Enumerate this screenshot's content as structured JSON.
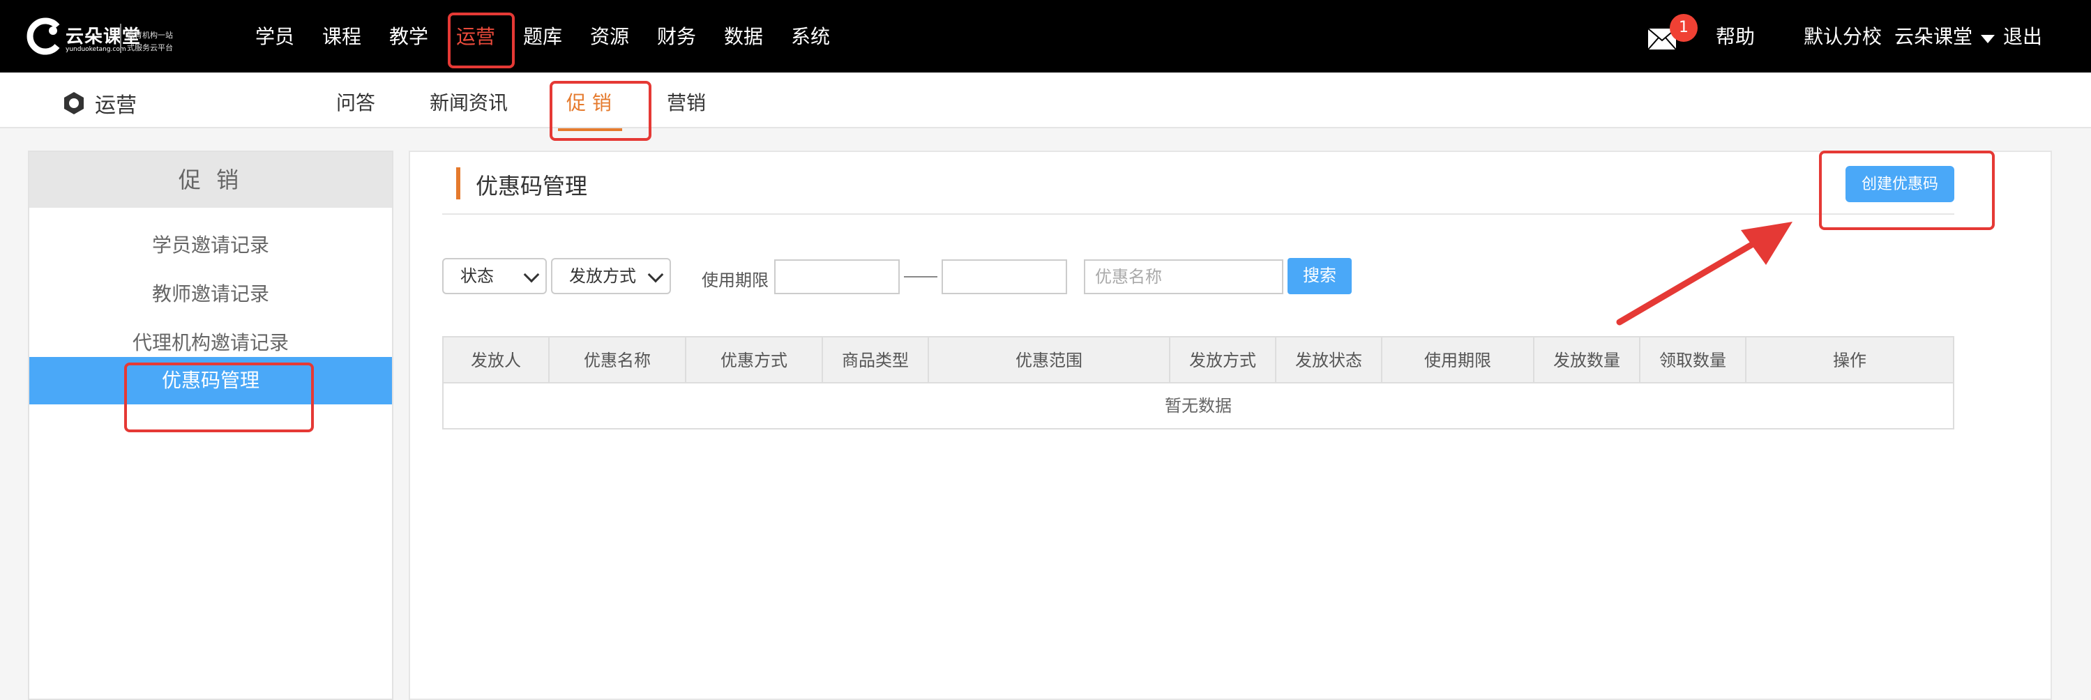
{
  "logo": {
    "brand": "云朵课堂",
    "domain": "yunduoketang.com",
    "tagline1": "教育机构一站",
    "tagline2": "式服务云平台"
  },
  "topnav": {
    "items": [
      "学员",
      "课程",
      "教学",
      "运营",
      "题库",
      "资源",
      "财务",
      "数据",
      "系统"
    ],
    "active": "运营",
    "mail_badge": "1",
    "help": "帮助",
    "school": "默认分校",
    "user": "云朵课堂",
    "logout": "退出"
  },
  "subnav": {
    "section": "运营",
    "tabs": [
      "问答",
      "新闻资讯",
      "促 销",
      "营销"
    ],
    "active": "促 销"
  },
  "sidebar": {
    "header": "促 销",
    "items": [
      "学员邀请记录",
      "教师邀请记录",
      "代理机构邀请记录",
      "优惠码管理"
    ],
    "active": "优惠码管理"
  },
  "main": {
    "title": "优惠码管理",
    "create_button": "创建优惠码",
    "filters": {
      "status": "状态",
      "issue_method": "发放方式",
      "period_label": "使用期限",
      "name_placeholder": "优惠名称",
      "search_button": "搜索"
    },
    "table": {
      "columns": [
        "发放人",
        "优惠名称",
        "优惠方式",
        "商品类型",
        "优惠范围",
        "发放方式",
        "发放状态",
        "使用期限",
        "发放数量",
        "领取数量",
        "操作"
      ],
      "empty_text": "暂无数据"
    }
  },
  "colors": {
    "accent_blue": "#4aa8f8",
    "accent_orange": "#e57a2d",
    "highlight_red": "#e53935"
  }
}
